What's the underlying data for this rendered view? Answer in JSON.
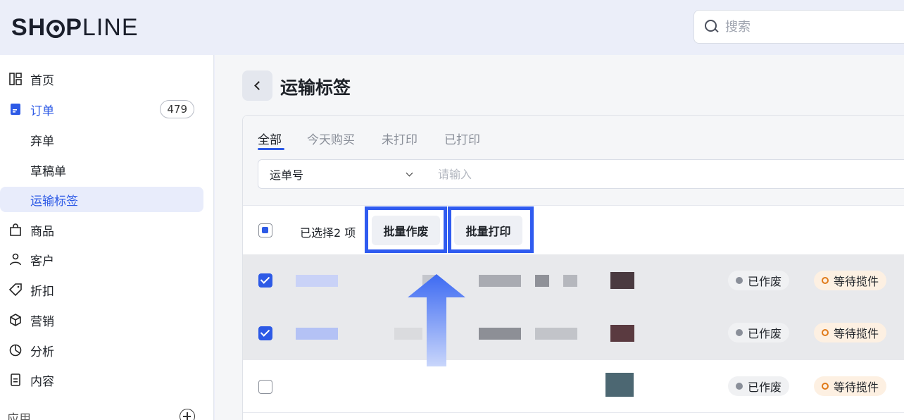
{
  "header": {
    "logo_text_bold": "SH",
    "logo_text_rest_bold": "P",
    "logo_text_light": "LINE",
    "search_placeholder": "搜索"
  },
  "sidebar": {
    "items": [
      {
        "label": "首页",
        "icon": "dashboard-icon"
      },
      {
        "label": "订单",
        "icon": "order-icon",
        "badge": "479"
      },
      {
        "label": "弃单"
      },
      {
        "label": "草稿单"
      },
      {
        "label": "运输标签"
      },
      {
        "label": "商品",
        "icon": "bag-icon"
      },
      {
        "label": "客户",
        "icon": "person-icon"
      },
      {
        "label": "折扣",
        "icon": "tag-icon"
      },
      {
        "label": "营销",
        "icon": "cube-icon"
      },
      {
        "label": "分析",
        "icon": "pie-chart-icon"
      },
      {
        "label": "内容",
        "icon": "document-icon"
      }
    ],
    "apps_label": "应用"
  },
  "main": {
    "title": "运输标签",
    "tabs": [
      "全部",
      "今天购买",
      "未打印",
      "已打印"
    ],
    "filter": {
      "select_value": "运单号",
      "input_placeholder": "请输入"
    },
    "bulk": {
      "selected_text": "已选择2 项",
      "void_button": "批量作废",
      "print_button": "批量打印"
    },
    "rows": [
      {
        "checked": true,
        "status_void": "已作废",
        "status_wait": "等待揽件"
      },
      {
        "checked": true,
        "status_void": "已作废",
        "status_wait": "等待揽件"
      },
      {
        "checked": false,
        "status_void": "已作废",
        "status_wait": "等待揽件"
      }
    ]
  },
  "colors": {
    "accent": "#2d5ae6",
    "highlight": "#2f5bf0",
    "status_wait": "#e07a1a",
    "status_void": "#8a8f99"
  }
}
